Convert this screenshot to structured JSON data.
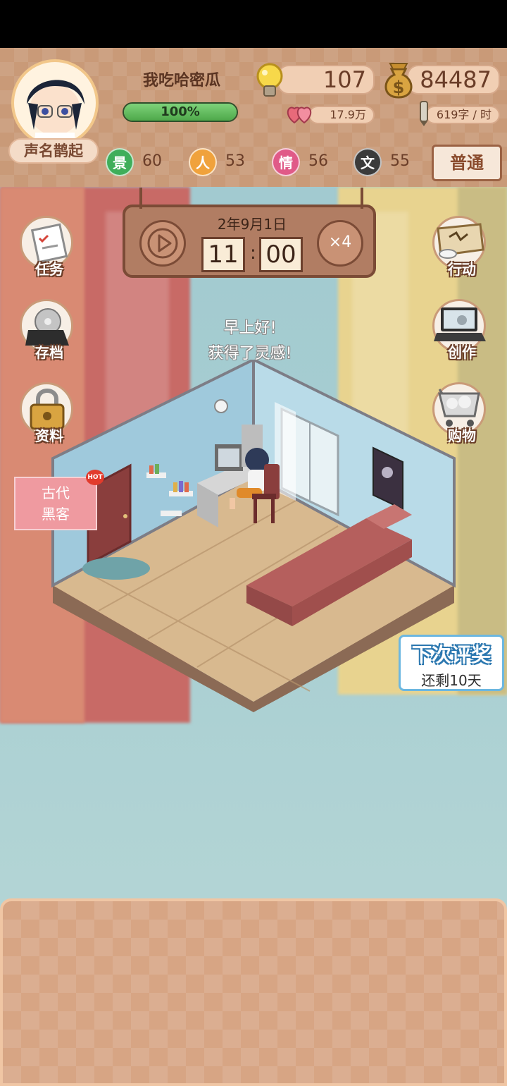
{
  "player": {
    "name": "我吃哈密瓜",
    "fame_title": "声名鹊起",
    "progress_text": "100%",
    "progress_fraction": 1.0
  },
  "resources": {
    "inspiration": "107",
    "money": "84487",
    "fans": "17.9万",
    "writing_speed": "619字 / 时"
  },
  "stats": [
    {
      "icon_text": "景",
      "value": "60",
      "color": "#3fae5a"
    },
    {
      "icon_text": "人",
      "value": "53",
      "color": "#f0a23c"
    },
    {
      "icon_text": "情",
      "value": "56",
      "color": "#e05a88"
    },
    {
      "icon_text": "文",
      "value": "55",
      "color": "#3b3b3b"
    }
  ],
  "mode_button": "普通",
  "clock": {
    "date": "2年9月1日",
    "hour": "11",
    "minute": "00",
    "speed": "×4"
  },
  "left_menu": [
    {
      "label": "任务",
      "icon": "clipboard-icon"
    },
    {
      "label": "存档",
      "icon": "laptop-disc-icon"
    },
    {
      "label": "资料",
      "icon": "padlock-icon"
    }
  ],
  "right_menu": [
    {
      "label": "行动",
      "icon": "map-scroll-icon"
    },
    {
      "label": "创作",
      "icon": "laptop-icon"
    },
    {
      "label": "购物",
      "icon": "shopping-cart-icon"
    }
  ],
  "speech": {
    "line1": "早上好!",
    "line2": "获得了灵感!"
  },
  "event_card": {
    "line1": "古代",
    "line2": "黑客",
    "badge": "HOT"
  },
  "award": {
    "title": "下次评奖",
    "remaining": "还剩10天"
  }
}
